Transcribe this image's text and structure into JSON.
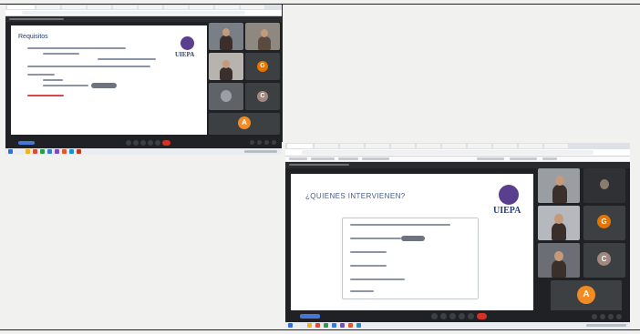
{
  "top_window": {
    "slide": {
      "title": "Requisitos",
      "logo_text": "UIEPA"
    },
    "participants": [
      {
        "kind": "photo"
      },
      {
        "kind": "photo"
      },
      {
        "kind": "photo"
      },
      {
        "kind": "avatar",
        "initial": "G",
        "color": "#e37400"
      },
      {
        "kind": "photo"
      },
      {
        "kind": "avatar",
        "initial": "C",
        "color": "#a1887f"
      },
      {
        "kind": "avatar",
        "initial": "A",
        "color": "#f28b24"
      }
    ]
  },
  "bottom_window": {
    "slide": {
      "title": "¿QUIENES INTERVIENEN?",
      "logo_text": "UIEPA"
    },
    "participants": [
      {
        "kind": "photo"
      },
      {
        "kind": "photo"
      },
      {
        "kind": "photo"
      },
      {
        "kind": "avatar",
        "initial": "G",
        "color": "#e37400"
      },
      {
        "kind": "photo"
      },
      {
        "kind": "avatar",
        "initial": "C",
        "color": "#a1887f"
      },
      {
        "kind": "avatar",
        "initial": "A",
        "color": "#f28b24"
      }
    ]
  },
  "colors": {
    "meet_bg": "#202124",
    "leave_button": "#d93025",
    "slide_title": "#1f3a78",
    "logo_purple": "#5b3f8f"
  },
  "icons": [
    "microphone-icon",
    "camera-icon",
    "captions-icon",
    "present-icon",
    "more-icon",
    "end-call-icon",
    "info-icon",
    "people-icon",
    "chat-icon",
    "activities-icon"
  ]
}
